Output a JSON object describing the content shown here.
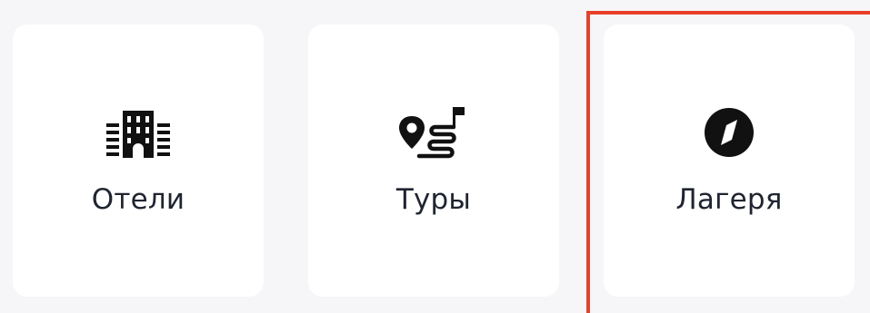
{
  "categories": [
    {
      "label": "Отели",
      "icon": "hotel-building-icon"
    },
    {
      "label": "Туры",
      "icon": "route-pin-flag-icon"
    },
    {
      "label": "Лагеря",
      "icon": "compass-icon"
    }
  ],
  "colors": {
    "page_background": "#f6f6f8",
    "card_background": "#ffffff",
    "text": "#1f2430",
    "icon": "#111111",
    "highlight": "#e8402a"
  }
}
